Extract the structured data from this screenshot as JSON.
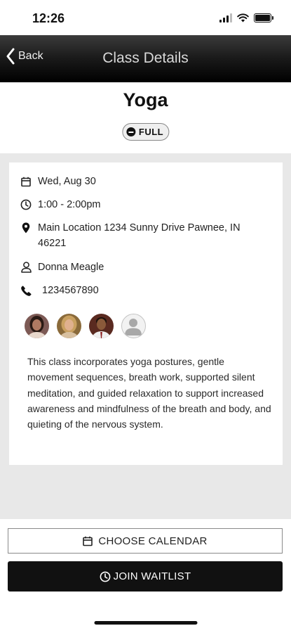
{
  "status_bar": {
    "time": "12:26"
  },
  "nav": {
    "back_label": "Back",
    "title": "Class Details"
  },
  "class": {
    "title": "Yoga",
    "status_badge": "FULL",
    "date": "Wed, Aug 30",
    "time": "1:00 - 2:00pm",
    "location": "Main Location 1234 Sunny Drive Pawnee, IN 46221",
    "instructor": "Donna Meagle",
    "phone": "1234567890",
    "attendees": [
      {
        "type": "photo",
        "skin": "#b07a62",
        "hair": "#2a1a14",
        "bg": "#7d5a55"
      },
      {
        "type": "photo",
        "skin": "#e0b08e",
        "hair": "#c9a060",
        "bg": "#8a6a3a"
      },
      {
        "type": "photo",
        "skin": "#8a5a3a",
        "hair": "#1e120c",
        "bg": "#5a2a20"
      },
      {
        "type": "placeholder"
      }
    ],
    "description": "This class incorporates yoga postures, gentle movement sequences, breath work, supported silent meditation, and guided relaxation to support increased awareness and mindfulness of the breath and body, and quieting of the nervous system."
  },
  "actions": {
    "choose_calendar_label": "CHOOSE CALENDAR",
    "join_waitlist_label": "JOIN WAITLIST"
  },
  "colors": {
    "nav_bg": "#000000",
    "primary_button_bg": "#111111",
    "page_gray": "#e8e8e8"
  }
}
